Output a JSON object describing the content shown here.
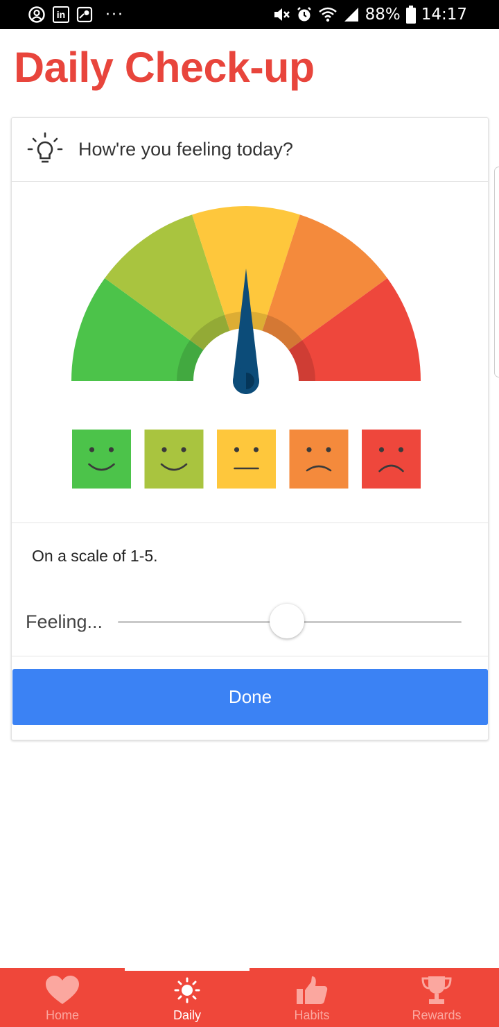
{
  "status_bar": {
    "battery": "88%",
    "time": "14:17",
    "linkedin_text": "in",
    "more_dots": "···"
  },
  "page": {
    "title": "Daily Check-up"
  },
  "card": {
    "question": "How're you feeling today?",
    "scale_text": "On a scale of 1-5.",
    "slider_label": "Feeling...",
    "slider_value_fraction": 0.5,
    "gauge_value_fraction": 0.5,
    "done_label": "Done"
  },
  "gauge": {
    "segment_colors": [
      "#4cc34a",
      "#a9c43f",
      "#fec73c",
      "#f48a3c",
      "#ee473c"
    ],
    "needle_color": "#0c4c79"
  },
  "moods": [
    {
      "name": "very-happy",
      "color": "#4cc34a"
    },
    {
      "name": "happy",
      "color": "#a9c43f"
    },
    {
      "name": "neutral",
      "color": "#fec73c"
    },
    {
      "name": "sad",
      "color": "#f48a3c"
    },
    {
      "name": "very-sad",
      "color": "#ee473c"
    }
  ],
  "bottom_nav": {
    "items": [
      {
        "label": "Home",
        "icon": "heart-icon",
        "active": false
      },
      {
        "label": "Daily",
        "icon": "sun-icon",
        "active": true
      },
      {
        "label": "Habits",
        "icon": "thumbs-up-icon",
        "active": false
      },
      {
        "label": "Rewards",
        "icon": "trophy-icon",
        "active": false
      }
    ],
    "background": "#ef473a"
  },
  "colors": {
    "title": "#e8453c",
    "primary_button": "#3b82f4"
  }
}
